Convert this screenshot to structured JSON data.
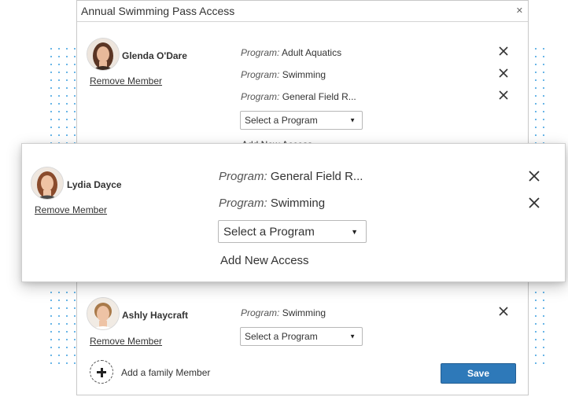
{
  "dialog": {
    "title": "Annual Swimming Pass Access",
    "close_icon": "close-icon"
  },
  "program_prefix": "Program:",
  "select_placeholder": "Select a Program",
  "add_new_access": "Add New Access",
  "remove_member": "Remove Member",
  "members": [
    {
      "name": "Glenda O'Dare",
      "programs": [
        "Adult Aquatics",
        "Swimming",
        "General Field R..."
      ]
    },
    {
      "name": "Lydia Dayce",
      "programs": [
        "General Field R...",
        "Swimming"
      ]
    },
    {
      "name": "Ashly Haycraft",
      "programs": [
        "Swimming"
      ]
    }
  ],
  "add_family_member": "Add a family Member",
  "save_label": "Save",
  "colors": {
    "accent": "#2e79b9",
    "dots": "#3a9fe0"
  }
}
